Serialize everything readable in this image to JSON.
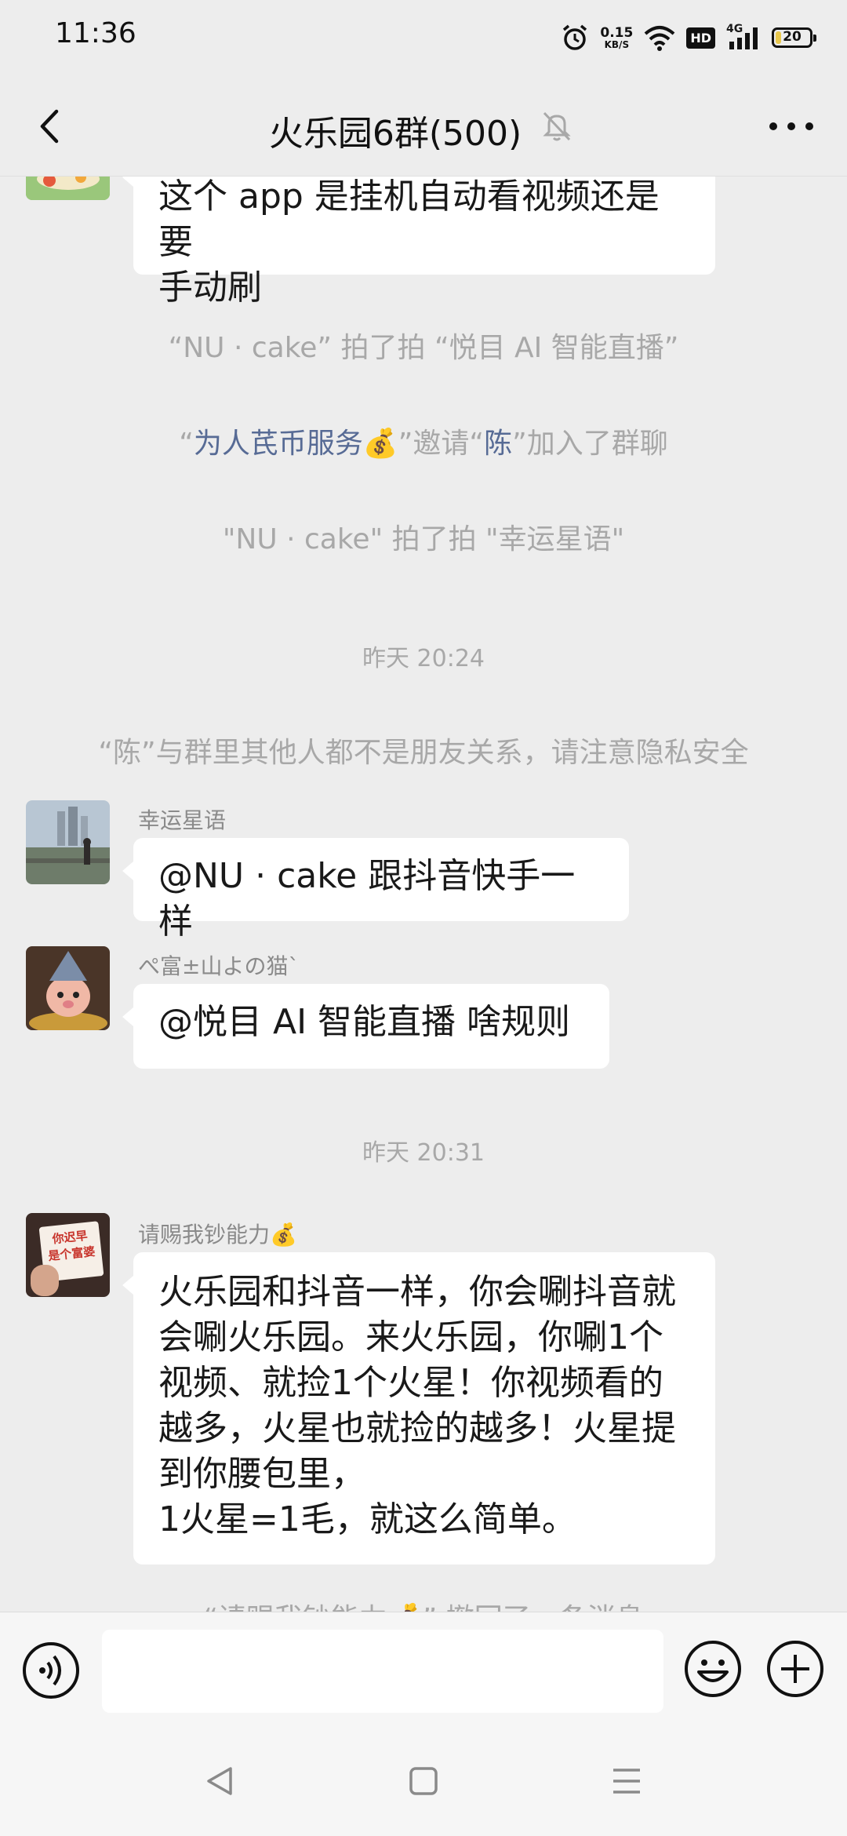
{
  "status_bar": {
    "time": "11:36",
    "net_speed_value": "0.15",
    "net_speed_unit": "KB/S",
    "hd": "HD",
    "network": "4G",
    "battery": "20",
    "battery_level_percent": 20,
    "icons": [
      "alarm-icon",
      "wifi-icon",
      "signal-icon",
      "battery-icon"
    ]
  },
  "header": {
    "title": "火乐园6群(500)",
    "icons": [
      "back-arrow-icon",
      "mute-bell-icon",
      "more-dots-icon"
    ]
  },
  "messages": [
    {
      "type": "message",
      "text_line1": "这个 app 是挂机自动看视频还是要",
      "text_line2": "手动刷"
    },
    {
      "type": "system",
      "text": "“NU · cake” 拍了拍 “悦目 AI 智能直播”"
    },
    {
      "type": "system",
      "part1": "“",
      "inviter": "为人芪币服务💰",
      "part2": "”邀请“",
      "invitee": "陈",
      "part3": "”加入了群聊"
    },
    {
      "type": "system",
      "text": "\"NU · cake\" 拍了拍 \"幸运星语\""
    },
    {
      "type": "time",
      "text": "昨天 20:24"
    },
    {
      "type": "system",
      "text": "“陈”与群里其他人都不是朋友关系，请注意隐私安全"
    },
    {
      "type": "message",
      "sender": "幸运星语",
      "text": "@NU · cake  跟抖音快手一样"
    },
    {
      "type": "message",
      "sender": "ぺ富±山よの猫`",
      "text": "@悦目 AI 智能直播  啥规则"
    },
    {
      "type": "time",
      "text": "昨天 20:31"
    },
    {
      "type": "message",
      "sender": "请赐我钞能力💰",
      "avatar_text_line1": "你迟早",
      "avatar_text_line2": "是个富婆",
      "lines": [
        "火乐园和抖音一样，你会唰抖音就",
        "会唰火乐园。来火乐园，你唰1个",
        "视频、就捡1个火星！你视频看的",
        "越多，火星也就捡的越多！火星提",
        "到你腰包里，",
        "1火星=1毛，就这么简单。"
      ]
    },
    {
      "type": "system",
      "text": "“请赐我钞能力💰” 撤回了一条消息"
    }
  ],
  "input_bar": {
    "placeholder": "",
    "icons": [
      "voice-icon",
      "emoji-icon",
      "plus-icon"
    ]
  },
  "nav_bar": {
    "icons": [
      "nav-back-icon",
      "nav-home-icon",
      "nav-menu-icon"
    ]
  }
}
